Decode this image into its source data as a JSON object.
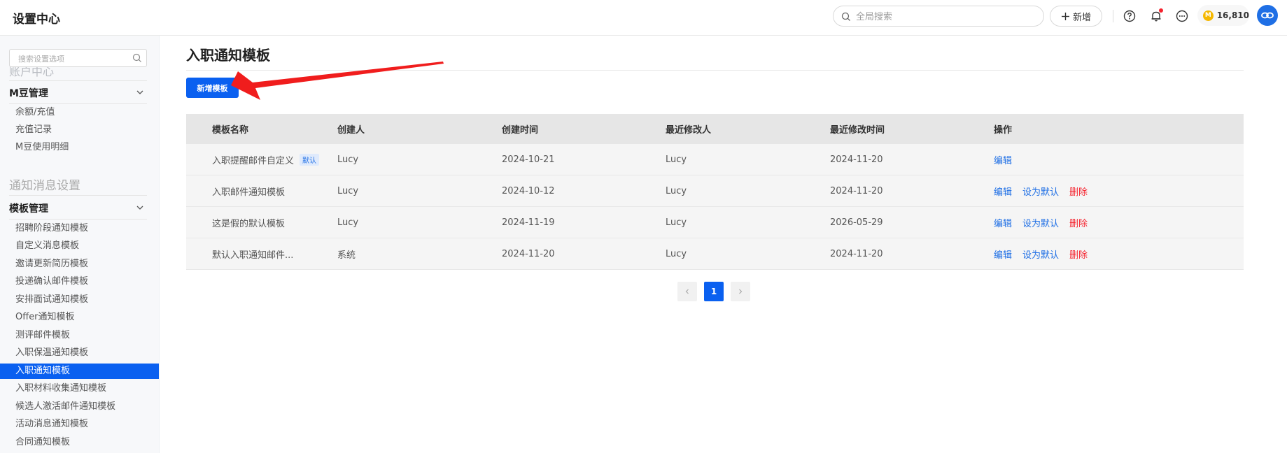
{
  "header": {
    "app_title": "设置中心",
    "search_placeholder": "全局搜索",
    "new_label": "新增",
    "coin_balance": "16,810"
  },
  "sidebar": {
    "search_placeholder": "搜索设置选项",
    "cut_section": "账户中心",
    "group_mdou": "M豆管理",
    "mdou_items": [
      "余额/充值",
      "充值记录",
      "M豆使用明细"
    ],
    "section_notify": "通知消息设置",
    "group_template": "模板管理",
    "template_items": [
      "招聘阶段通知模板",
      "自定义消息模板",
      "邀请更新简历模板",
      "投递确认邮件模板",
      "安排面试通知模板",
      "Offer通知模板",
      "测评邮件模板",
      "入职保温通知模板",
      "入职通知模板",
      "入职材料收集通知模板",
      "候选人激活邮件通知模板",
      "活动消息通知模板",
      "合同通知模板"
    ],
    "active_index": 8
  },
  "main": {
    "title": "入职通知模板",
    "add_button": "新增模板",
    "columns": [
      "模板名称",
      "创建人",
      "创建时间",
      "最近修改人",
      "最近修改时间",
      "操作"
    ],
    "rows": [
      {
        "name": "入职提醒邮件自定义",
        "badge": "默认",
        "creator": "Lucy",
        "created": "2024-10-21",
        "modifier": "Lucy",
        "modified": "2024-11-20",
        "ops": [
          "编辑"
        ]
      },
      {
        "name": "入职邮件通知模板",
        "badge": "",
        "creator": "Lucy",
        "created": "2024-10-12",
        "modifier": "Lucy",
        "modified": "2024-11-20",
        "ops": [
          "编辑",
          "设为默认",
          "删除"
        ]
      },
      {
        "name": "这是假的默认模板",
        "badge": "",
        "creator": "Lucy",
        "created": "2024-11-19",
        "modifier": "Lucy",
        "modified": "2026-05-29",
        "ops": [
          "编辑",
          "设为默认",
          "删除"
        ]
      },
      {
        "name": "默认入职通知邮件...",
        "badge": "",
        "creator": "系统",
        "created": "2024-11-20",
        "modifier": "Lucy",
        "modified": "2024-11-20",
        "ops": [
          "编辑",
          "设为默认",
          "删除"
        ]
      }
    ],
    "pagination": {
      "current": "1"
    }
  },
  "colors": {
    "primary": "#0a60f0",
    "danger": "#f5222d",
    "arrow": "#f01d1d"
  }
}
